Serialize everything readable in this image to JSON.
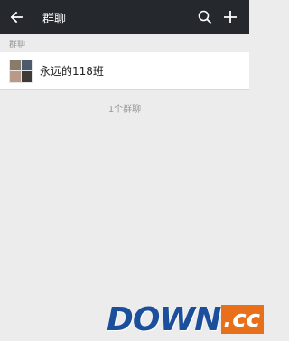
{
  "header": {
    "title": "群聊",
    "back_icon": "back-arrow-icon",
    "search_icon": "search-icon",
    "add_icon": "plus-icon",
    "bg_color": "#25282d"
  },
  "section": {
    "label": "群聊"
  },
  "groups": [
    {
      "name": "永远的118班",
      "avatar": "group-avatar"
    }
  ],
  "footer": {
    "count_text": "1个群聊"
  },
  "watermark": {
    "main": "DOWN",
    "suffix": ".cc"
  }
}
